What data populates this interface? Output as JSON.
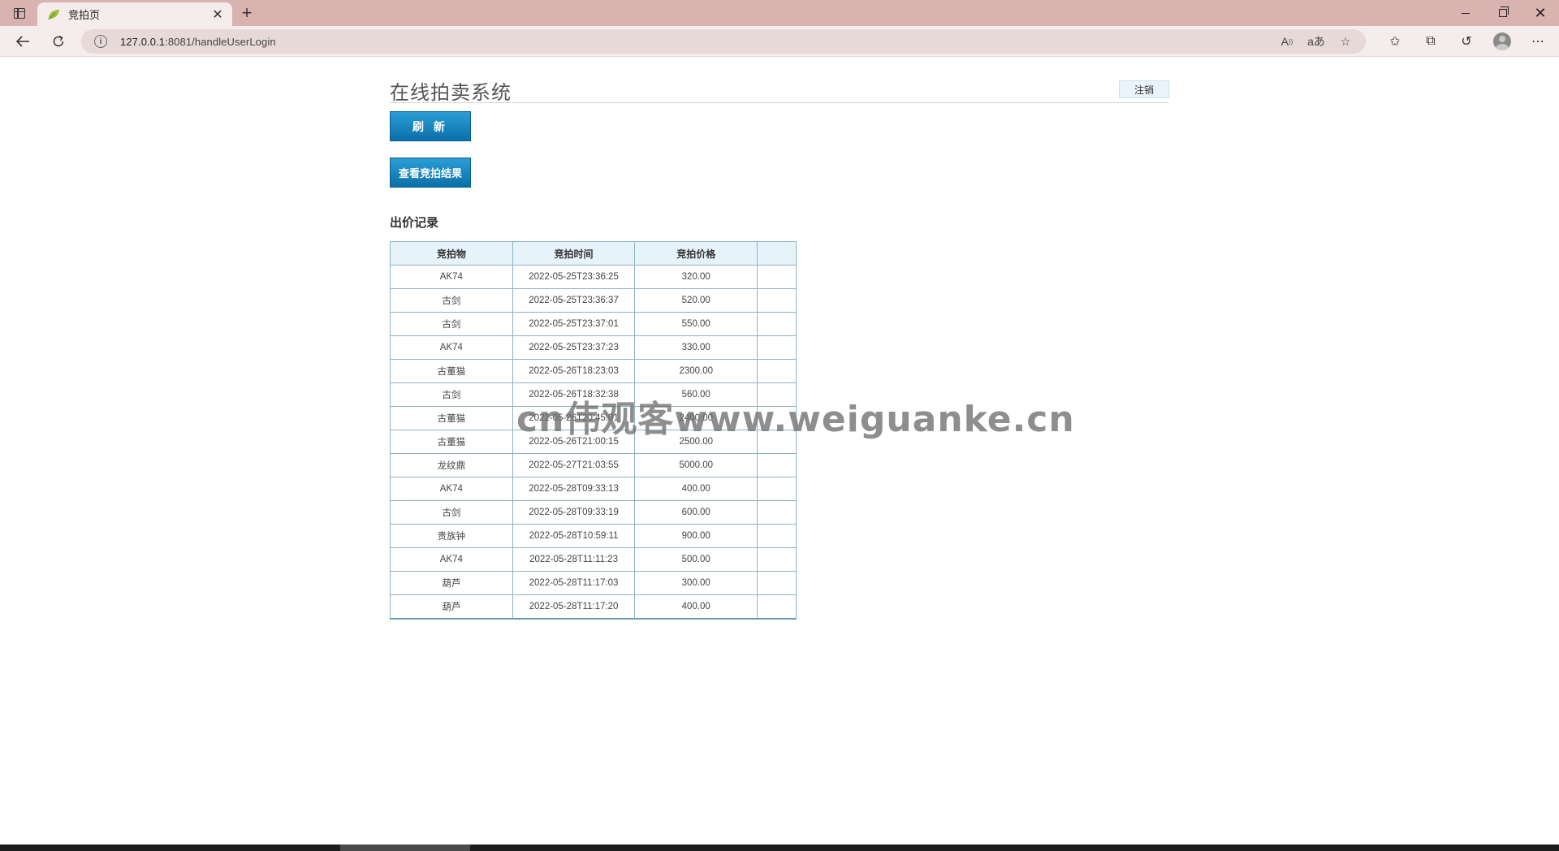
{
  "browser": {
    "tab_title": "竞拍页",
    "url_host": "127.0.0.1",
    "url_rest": ":8081/handleUserLogin"
  },
  "site": {
    "title": "在线拍卖系统",
    "logout_label": "注销"
  },
  "actions": {
    "refresh_label": "刷 新",
    "results_label": "查看竞拍结果"
  },
  "bids": {
    "section_title": "出价记录",
    "headers": [
      "竞拍物",
      "竞拍时间",
      "竞拍价格",
      ""
    ],
    "rows": [
      {
        "item": "AK74",
        "time": "2022-05-25T23:36:25",
        "price": "320.00"
      },
      {
        "item": "古剑",
        "time": "2022-05-25T23:36:37",
        "price": "520.00"
      },
      {
        "item": "古剑",
        "time": "2022-05-25T23:37:01",
        "price": "550.00"
      },
      {
        "item": "AK74",
        "time": "2022-05-25T23:37:23",
        "price": "330.00"
      },
      {
        "item": "古董猫",
        "time": "2022-05-26T18:23:03",
        "price": "2300.00"
      },
      {
        "item": "古剑",
        "time": "2022-05-26T18:32:38",
        "price": "560.00"
      },
      {
        "item": "古董猫",
        "time": "2022-05-26T20:45:01",
        "price": "2400.00"
      },
      {
        "item": "古董猫",
        "time": "2022-05-26T21:00:15",
        "price": "2500.00"
      },
      {
        "item": "龙纹鼎",
        "time": "2022-05-27T21:03:55",
        "price": "5000.00"
      },
      {
        "item": "AK74",
        "time": "2022-05-28T09:33:13",
        "price": "400.00"
      },
      {
        "item": "古剑",
        "time": "2022-05-28T09:33:19",
        "price": "600.00"
      },
      {
        "item": "贵族钟",
        "time": "2022-05-28T10:59:11",
        "price": "900.00"
      },
      {
        "item": "AK74",
        "time": "2022-05-28T11:11:23",
        "price": "500.00"
      },
      {
        "item": "葫芦",
        "time": "2022-05-28T11:17:03",
        "price": "300.00"
      },
      {
        "item": "葫芦",
        "time": "2022-05-28T11:17:20",
        "price": "400.00"
      }
    ]
  },
  "watermark": "cn伟观客www.weiguanke.cn"
}
